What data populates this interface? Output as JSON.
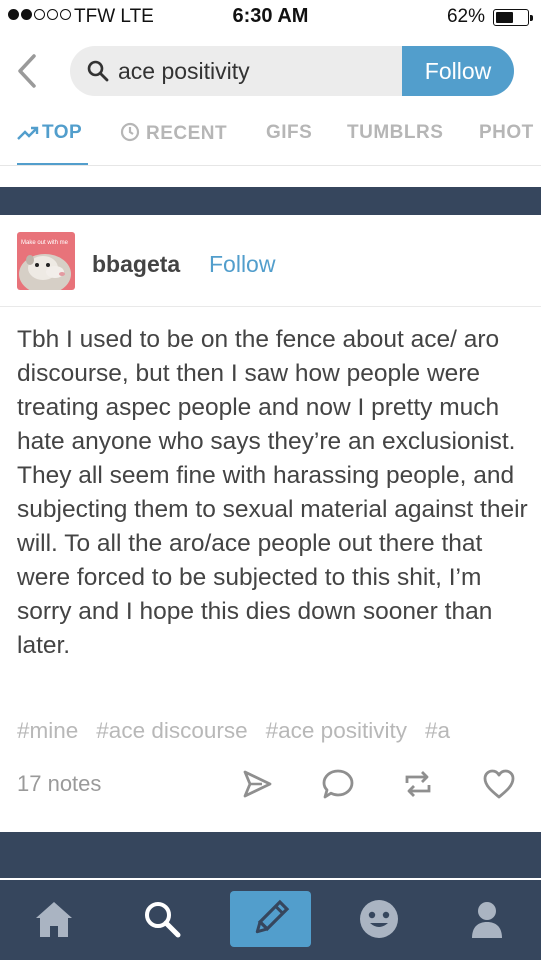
{
  "status_bar": {
    "carrier": "TFW  LTE",
    "time": "6:30 AM",
    "battery": "62%",
    "battery_level": 0.62
  },
  "search": {
    "query": "ace positivity",
    "follow_label": "Follow"
  },
  "tabs": [
    {
      "label": "TOP",
      "icon": "trending-icon",
      "active": true
    },
    {
      "label": "RECENT",
      "icon": "clock-icon",
      "active": false
    },
    {
      "label": "GIFS",
      "active": false
    },
    {
      "label": "TUMBLRS",
      "active": false
    },
    {
      "label": "PHOT",
      "active": false
    }
  ],
  "post": {
    "avatar_caption": "Make out with me",
    "blog_name": "bbageta",
    "follow_label": "Follow",
    "body": "Tbh I used to be on the fence about ace/ aro discourse, but then I saw how people were treating aspec people and now I pretty much hate anyone who says they’re an exclusionist. They all seem fine with harassing people, and subjecting them to sexual material against their will. To all the aro/ace people out there that were forced to be subjected to this shit, I’m sorry and I hope this dies down sooner than later.",
    "tags": [
      "#mine",
      "#ace discourse",
      "#ace positivity",
      "#a"
    ],
    "notes": "17 notes",
    "actions": [
      "share-icon",
      "reply-icon",
      "reblog-icon",
      "heart-icon"
    ]
  },
  "nav": [
    "home-icon",
    "search-icon",
    "compose-icon",
    "activity-icon",
    "account-icon"
  ],
  "colors": {
    "accent": "#529ecc",
    "navy": "#36465d"
  }
}
